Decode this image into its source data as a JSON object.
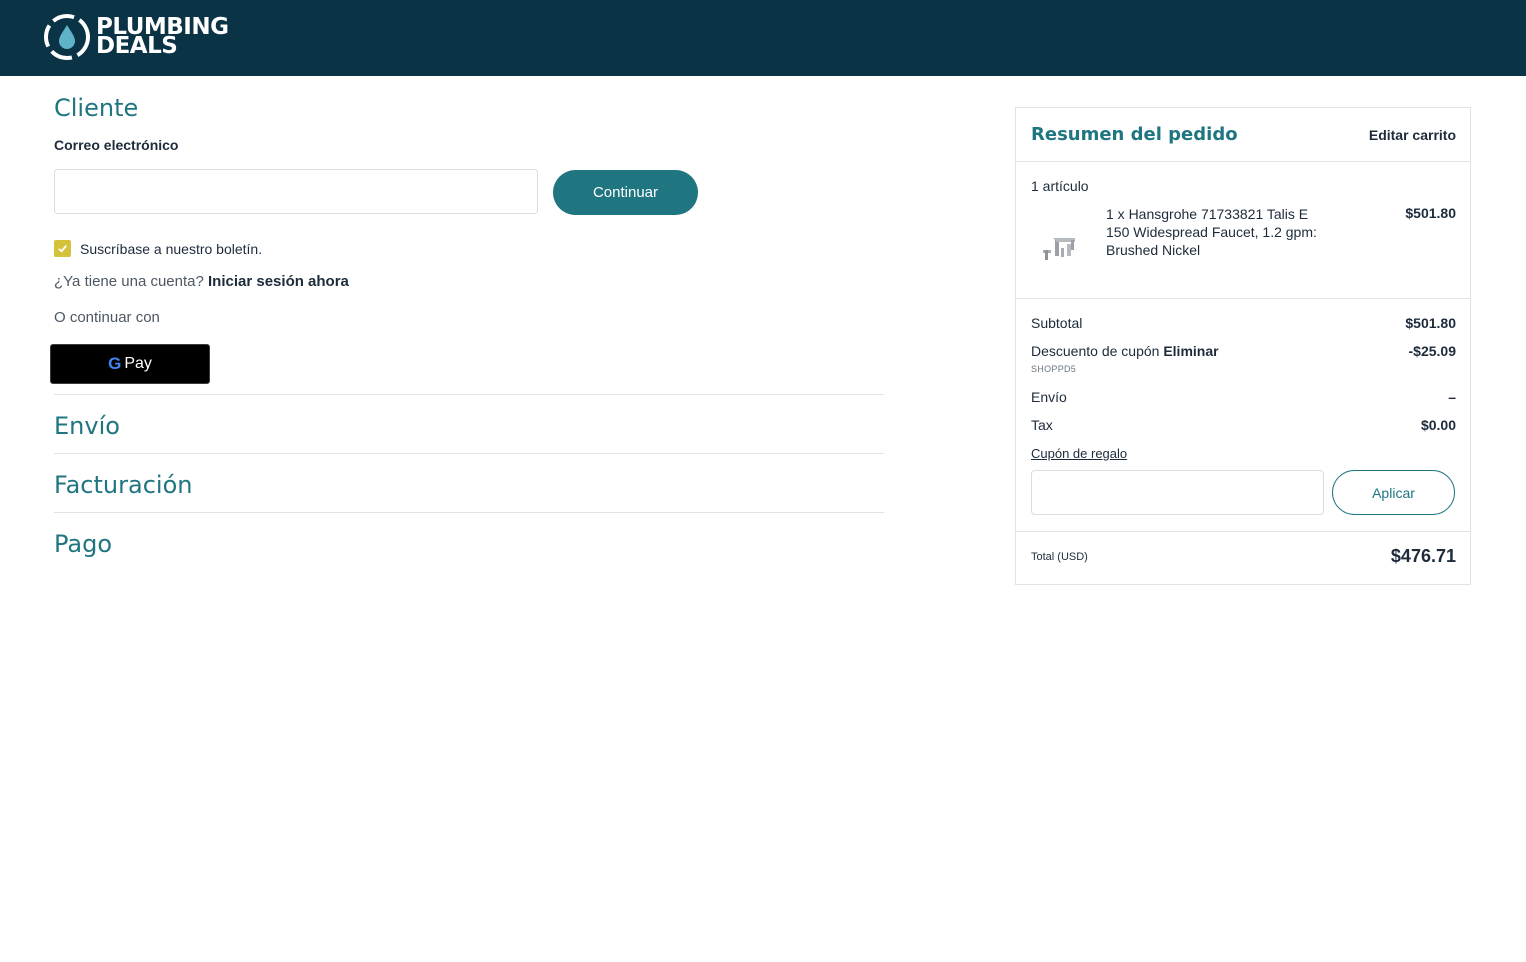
{
  "brand": {
    "name_line1": "PLUMBING",
    "name_line2": "DEALS",
    "header_color": "#0a3446",
    "accent_color": "#1f7681"
  },
  "customer": {
    "title": "Cliente",
    "email_label": "Correo electrónico",
    "email_value": "",
    "continue_label": "Continuar",
    "newsletter_label": "Suscríbase a nuestro boletín.",
    "newsletter_checked": true,
    "account_prompt": "¿Ya tiene una cuenta?",
    "signin_label": "Iniciar sesión ahora",
    "or_continue_label": "O continuar con",
    "gpay_g": "G",
    "gpay_label": "Pay"
  },
  "steps": {
    "shipping": "Envío",
    "billing": "Facturación",
    "payment": "Pago"
  },
  "summary": {
    "title": "Resumen del pedido",
    "edit_cart": "Editar carrito",
    "items_count": "1 artículo",
    "item": {
      "name": "1 x Hansgrohe 71733821 Talis E 150 Widespread Faucet, 1.2 gpm: Brushed Nickel",
      "price": "$501.80",
      "icon": "faucet-thumbnail"
    },
    "subtotal_label": "Subtotal",
    "subtotal_value": "$501.80",
    "discount_label": "Descuento de cupón",
    "discount_remove": "Eliminar",
    "discount_value": "-$25.09",
    "coupon_code": "SHOPPD5",
    "shipping_label": "Envío",
    "shipping_value": "–",
    "tax_label": "Tax",
    "tax_value": "$0.00",
    "gift_label": "Cupón de regalo",
    "gift_value": "",
    "apply_label": "Aplicar",
    "total_label": "Total (USD)",
    "total_value": "$476.71"
  }
}
